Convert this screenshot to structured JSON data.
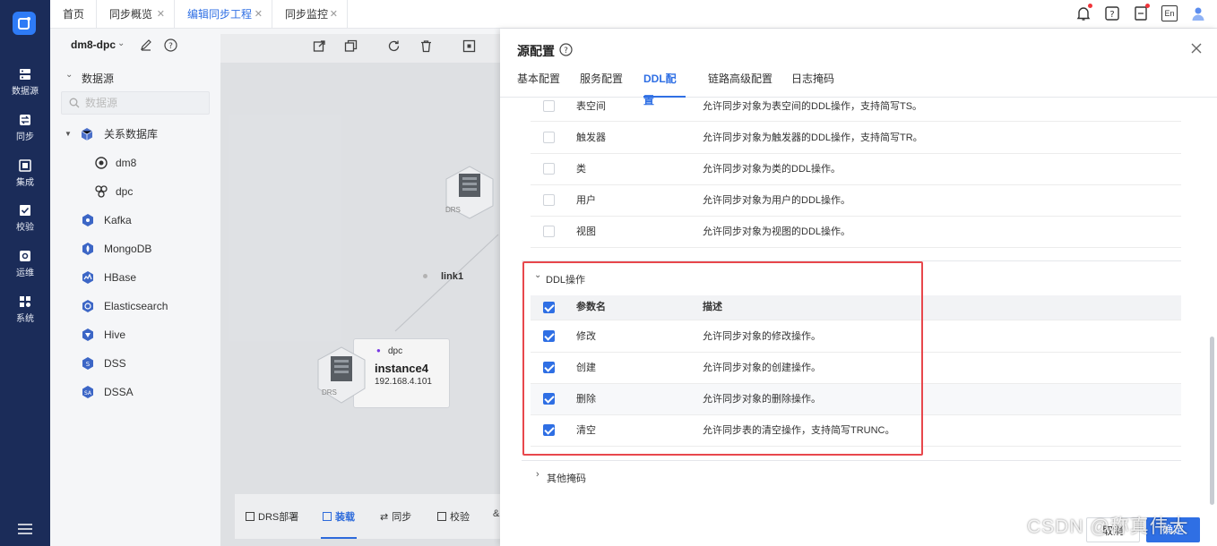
{
  "nav": {
    "items": [
      {
        "label": "数据源",
        "icon": "database-icon"
      },
      {
        "label": "同步",
        "icon": "sync-icon"
      },
      {
        "label": "集成",
        "icon": "integration-icon"
      },
      {
        "label": "校验",
        "icon": "check-icon"
      },
      {
        "label": "运维",
        "icon": "ops-icon"
      },
      {
        "label": "系统",
        "icon": "apps-icon"
      }
    ]
  },
  "tabs": [
    {
      "label": "首页"
    },
    {
      "label": "同步概览"
    },
    {
      "label": "编辑同步工程"
    },
    {
      "label": "同步监控"
    }
  ],
  "header": {
    "lang": "En"
  },
  "project": {
    "name": "dm8-dpc"
  },
  "tree": {
    "title": "数据源",
    "search_placeholder": "数据源",
    "items": [
      {
        "label": "关系数据库"
      },
      {
        "label": "dm8"
      },
      {
        "label": "dpc"
      },
      {
        "label": "Kafka"
      },
      {
        "label": "MongoDB"
      },
      {
        "label": "HBase"
      },
      {
        "label": "Elasticsearch"
      },
      {
        "label": "Hive"
      },
      {
        "label": "DSS"
      },
      {
        "label": "DSSA"
      }
    ]
  },
  "canvas": {
    "node1": {
      "badge": "DRS"
    },
    "node2": {
      "type": "dpc",
      "name": "instance4",
      "ip": "192.168.4.101",
      "badge": "DRS"
    },
    "link": "link1",
    "bottom_tabs": [
      "DRS部署",
      "装载",
      "同步",
      "校验"
    ]
  },
  "panel": {
    "title": "源配置",
    "tabs": [
      "基本配置",
      "服务配置",
      "DDL配置",
      "链路高级配置",
      "日志掩码"
    ],
    "upper_rows": [
      {
        "name": "表空间",
        "desc": "允许同步对象为表空间的DDL操作，支持简写TS。"
      },
      {
        "name": "触发器",
        "desc": "允许同步对象为触发器的DDL操作，支持简写TR。"
      },
      {
        "name": "类",
        "desc": "允许同步对象为类的DDL操作。"
      },
      {
        "name": "用户",
        "desc": "允许同步对象为用户的DDL操作。"
      },
      {
        "name": "视图",
        "desc": "允许同步对象为视图的DDL操作。"
      }
    ],
    "ddl_section": {
      "title": "DDL操作",
      "col_name": "参数名",
      "col_desc": "描述",
      "rows": [
        {
          "name": "修改",
          "desc": "允许同步对象的修改操作。"
        },
        {
          "name": "创建",
          "desc": "允许同步对象的创建操作。"
        },
        {
          "name": "删除",
          "desc": "允许同步对象的删除操作。"
        },
        {
          "name": "清空",
          "desc": "允许同步表的清空操作，支持简写TRUNC。"
        }
      ]
    },
    "other_section": {
      "title": "其他掩码"
    },
    "cancel": "取消",
    "confirm": "确定"
  },
  "watermark": "CSDN @称真伟大"
}
